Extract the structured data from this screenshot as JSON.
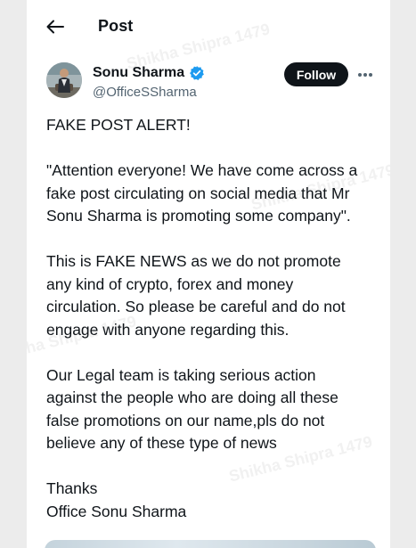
{
  "header": {
    "title": "Post"
  },
  "author": {
    "display_name": "Sonu Sharma",
    "handle": "@OfficeSSharma",
    "verified": true,
    "verified_color": "#1d9bf0"
  },
  "actions": {
    "follow_label": "Follow"
  },
  "post": {
    "paragraphs": [
      "FAKE POST ALERT!",
      "\"Attention everyone! We have come across a\nfake post circulating on social media that Mr\nSonu Sharma is promoting some company\".",
      "This is FAKE NEWS as we do not promote\nany kind of crypto, forex and money\ncirculation. So please be careful and do not\nengage with anyone regarding this.",
      "Our Legal team is taking serious action\nagainst the people who are doing all these\nfalse promotions on our name,pls do not\nbelieve any of these type of news",
      "Thanks\nOffice Sonu Sharma"
    ]
  },
  "watermarks": {
    "text_a": "Shikha Shipra 1479",
    "text_b": "Shikha Shipra 1479",
    "text_c": "Shikha Shipra 1479",
    "text_d": "Shikha Shipra 1479"
  },
  "icons": {
    "back": "arrow-left-icon",
    "more": "more-horizontal-icon",
    "verified": "verified-badge-icon"
  }
}
